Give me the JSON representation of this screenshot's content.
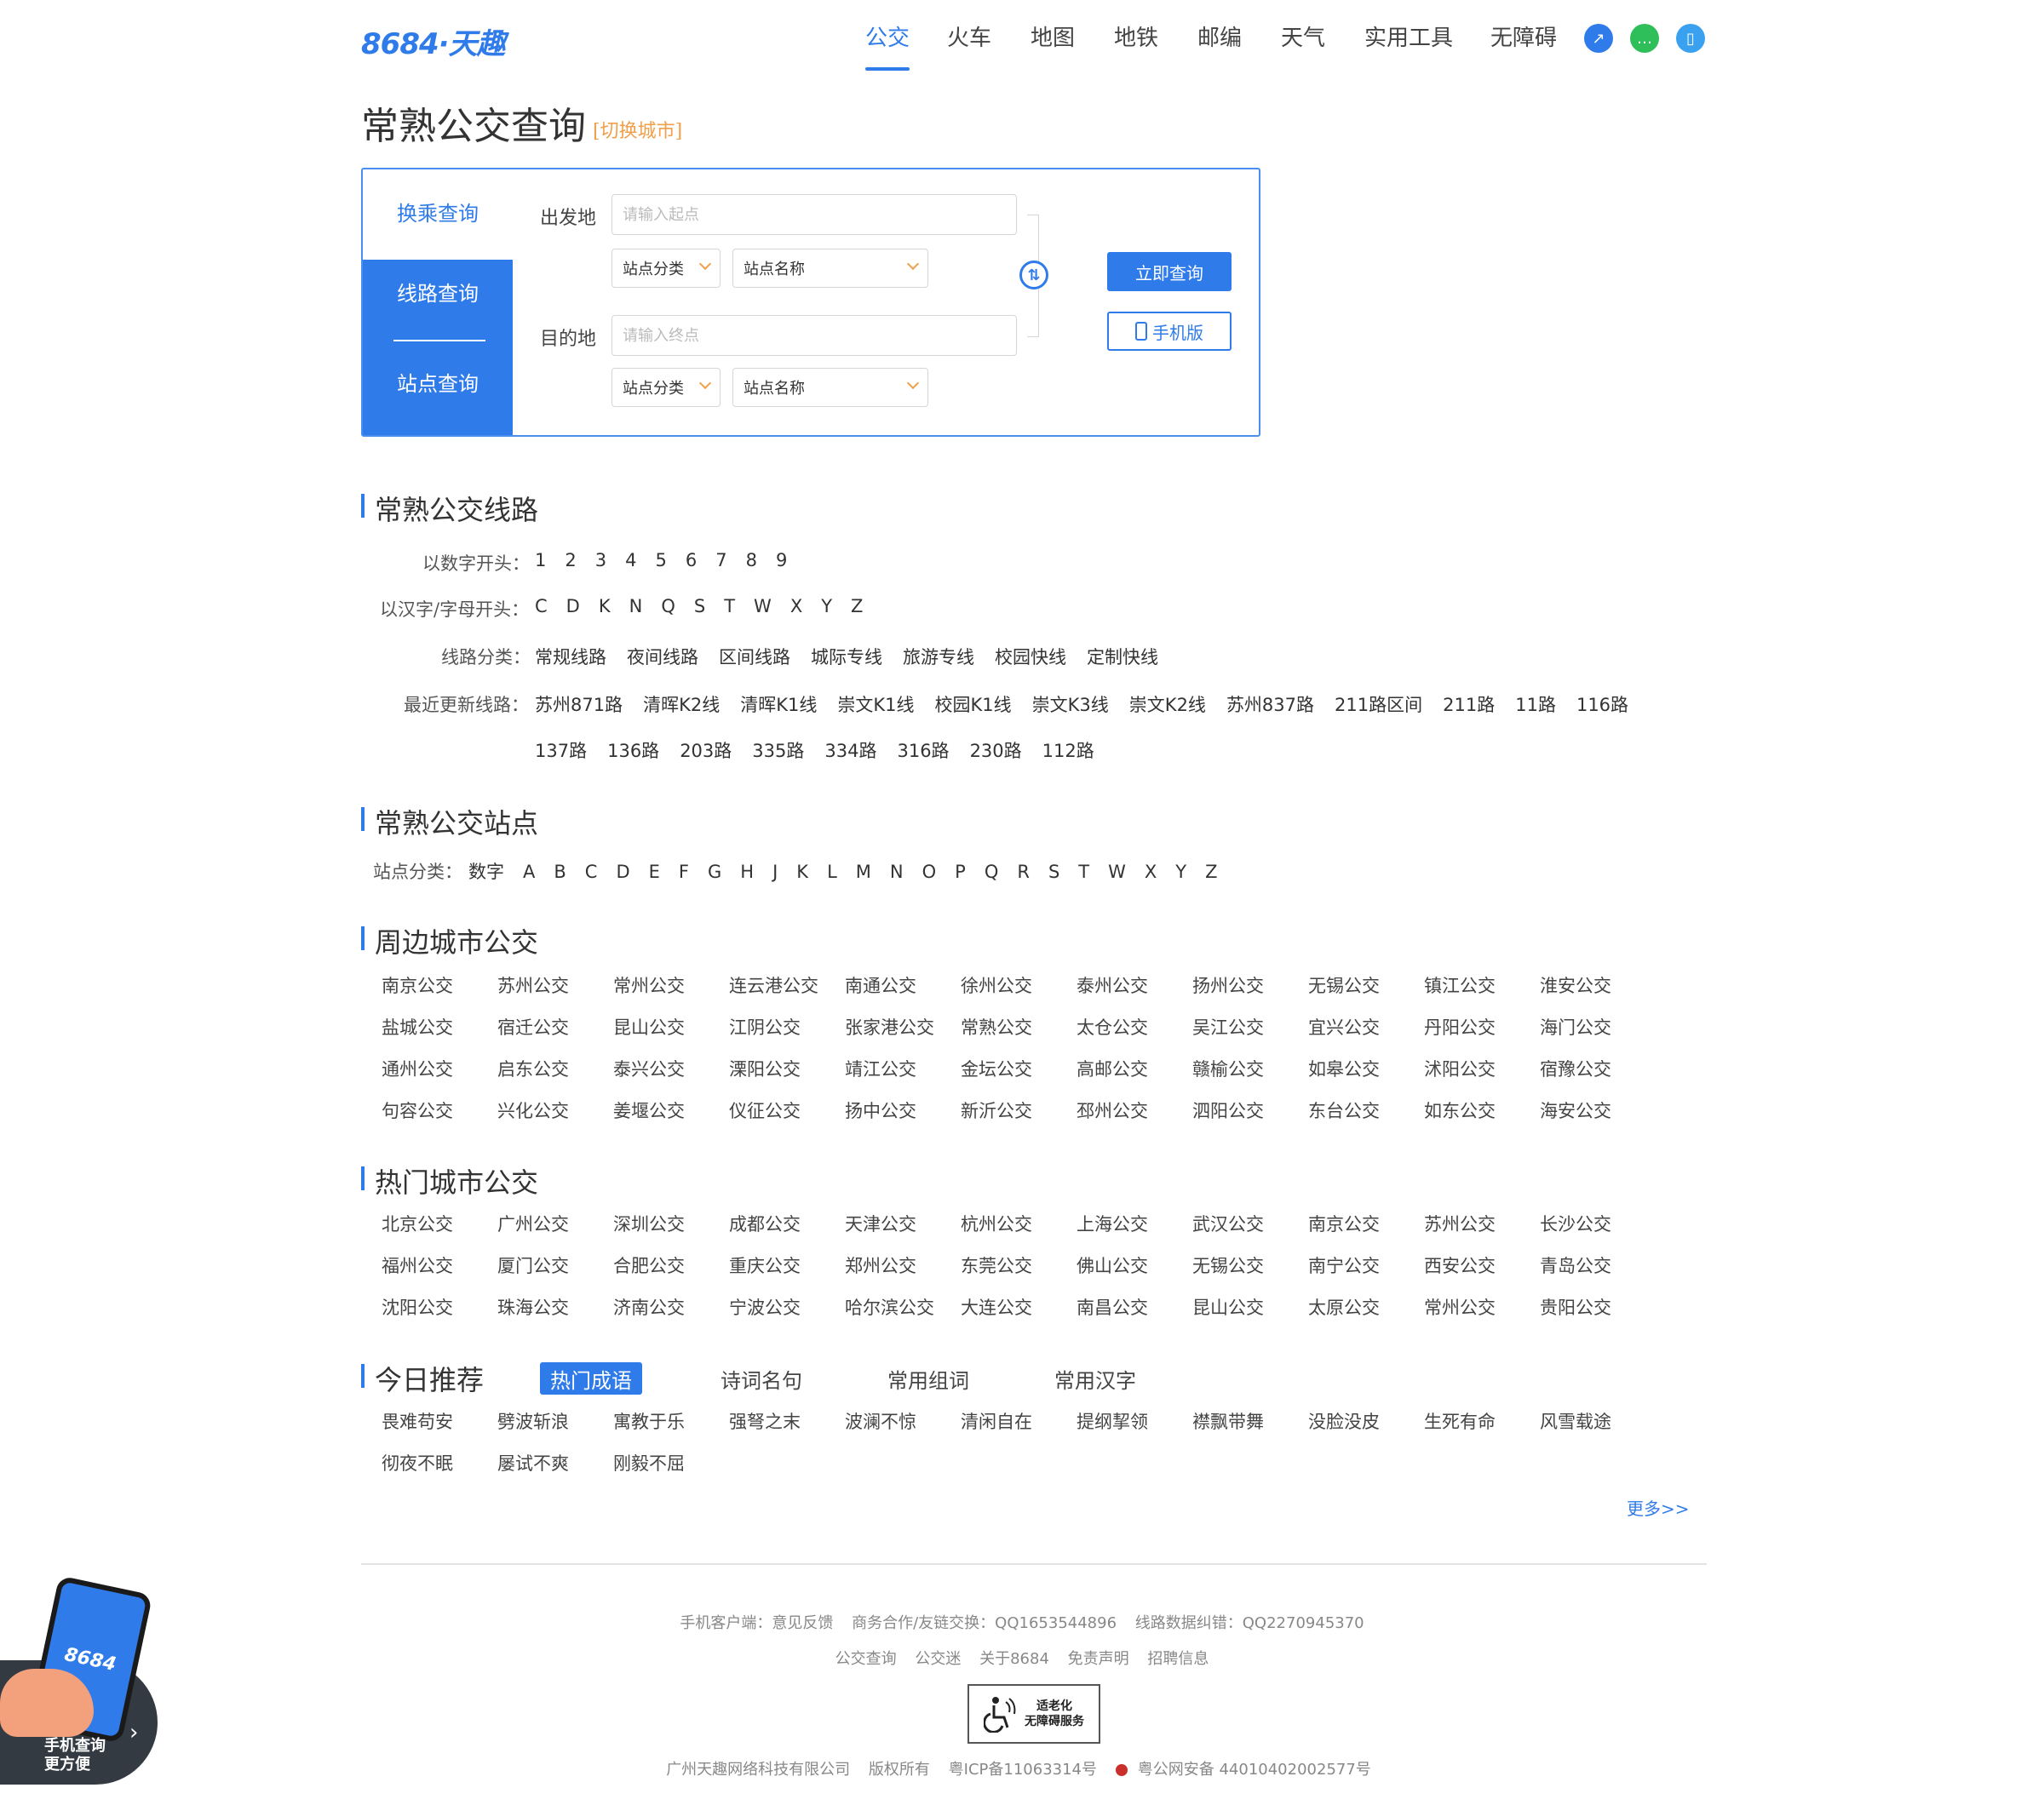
{
  "header": {
    "logo": "8684·天趣",
    "nav": [
      "公交",
      "火车",
      "地图",
      "地铁",
      "邮编",
      "天气",
      "实用工具",
      "无障碍"
    ],
    "icons": [
      "link-icon",
      "wechat-icon",
      "mobile-icon"
    ]
  },
  "page": {
    "title": "常熟公交查询",
    "switch_city": "[切换城市]"
  },
  "search": {
    "tabs": {
      "transfer": "换乘查询",
      "line": "线路查询",
      "station": "站点查询"
    },
    "from_label": "出发地",
    "from_placeholder": "请输入起点",
    "to_label": "目的地",
    "to_placeholder": "请输入终点",
    "select_category": "站点分类",
    "select_name": "站点名称",
    "submit": "立即查询",
    "mobile": "手机版"
  },
  "lines": {
    "title": "常熟公交线路",
    "numeric_label": "以数字开头：",
    "numeric": [
      "1",
      "2",
      "3",
      "4",
      "5",
      "6",
      "7",
      "8",
      "9"
    ],
    "alpha_label": "以汉字/字母开头：",
    "alpha": [
      "C",
      "D",
      "K",
      "N",
      "Q",
      "S",
      "T",
      "W",
      "X",
      "Y",
      "Z"
    ],
    "category_label": "线路分类：",
    "categories": [
      "常规线路",
      "夜间线路",
      "区间线路",
      "城际专线",
      "旅游专线",
      "校园快线",
      "定制快线"
    ],
    "recent_label": "最近更新线路：",
    "recent_row1": [
      "苏州871路",
      "清晖K2线",
      "清晖K1线",
      "崇文K1线",
      "校园K1线",
      "崇文K3线",
      "崇文K2线",
      "苏州837路",
      "211路区间",
      "211路",
      "11路",
      "116路"
    ],
    "recent_row2": [
      "137路",
      "136路",
      "203路",
      "335路",
      "334路",
      "316路",
      "230路",
      "112路"
    ]
  },
  "stations": {
    "title": "常熟公交站点",
    "label": "站点分类：",
    "items": [
      "数字",
      "A",
      "B",
      "C",
      "D",
      "E",
      "F",
      "G",
      "H",
      "J",
      "K",
      "L",
      "M",
      "N",
      "O",
      "P",
      "Q",
      "R",
      "S",
      "T",
      "W",
      "X",
      "Y",
      "Z"
    ]
  },
  "nearby": {
    "title": "周边城市公交",
    "items": [
      "南京公交",
      "苏州公交",
      "常州公交",
      "连云港公交",
      "南通公交",
      "徐州公交",
      "泰州公交",
      "扬州公交",
      "无锡公交",
      "镇江公交",
      "淮安公交",
      "盐城公交",
      "宿迁公交",
      "昆山公交",
      "江阴公交",
      "张家港公交",
      "常熟公交",
      "太仓公交",
      "吴江公交",
      "宜兴公交",
      "丹阳公交",
      "海门公交",
      "通州公交",
      "启东公交",
      "泰兴公交",
      "溧阳公交",
      "靖江公交",
      "金坛公交",
      "高邮公交",
      "赣榆公交",
      "如皋公交",
      "沭阳公交",
      "宿豫公交",
      "句容公交",
      "兴化公交",
      "姜堰公交",
      "仪征公交",
      "扬中公交",
      "新沂公交",
      "邳州公交",
      "泗阳公交",
      "东台公交",
      "如东公交",
      "海安公交"
    ]
  },
  "hot": {
    "title": "热门城市公交",
    "items": [
      "北京公交",
      "广州公交",
      "深圳公交",
      "成都公交",
      "天津公交",
      "杭州公交",
      "上海公交",
      "武汉公交",
      "南京公交",
      "苏州公交",
      "长沙公交",
      "福州公交",
      "厦门公交",
      "合肥公交",
      "重庆公交",
      "郑州公交",
      "东莞公交",
      "佛山公交",
      "无锡公交",
      "南宁公交",
      "西安公交",
      "青岛公交",
      "沈阳公交",
      "珠海公交",
      "济南公交",
      "宁波公交",
      "哈尔滨公交",
      "大连公交",
      "南昌公交",
      "昆山公交",
      "太原公交",
      "常州公交",
      "贵阳公交"
    ]
  },
  "recommend": {
    "title": "今日推荐",
    "tabs": [
      "热门成语",
      "诗词名句",
      "常用组词",
      "常用汉字"
    ],
    "items": [
      "畏难苟安",
      "劈波斩浪",
      "寓教于乐",
      "强弩之末",
      "波澜不惊",
      "清闲自在",
      "提纲挈领",
      "襟飘带舞",
      "没脸没皮",
      "生死有命",
      "风雪载途",
      "彻夜不眠",
      "屡试不爽",
      "刚毅不屈"
    ],
    "more": "更多>>"
  },
  "footer": {
    "line1": [
      "手机客户端：意见反馈",
      "商务合作/友链交换：QQ1653544896",
      "线路数据纠错：QQ2270945370"
    ],
    "line2": [
      "公交查询",
      "公交迷",
      "关于8684",
      "免责声明",
      "招聘信息"
    ],
    "badge": [
      "适老化",
      "无障碍服务"
    ],
    "company": "广州天趣网络科技有限公司",
    "rights": "版权所有",
    "icp": "粤ICP备11063314号",
    "police": "粤公网安备 44010402002577号"
  },
  "promo": {
    "brand": "8684",
    "text": [
      "手机查询",
      "更方便"
    ]
  },
  "colors": {
    "accent": "#2f7bea",
    "orange": "#f0a04b"
  }
}
